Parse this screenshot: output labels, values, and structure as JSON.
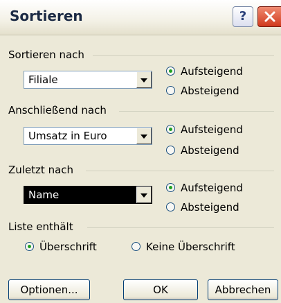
{
  "window": {
    "title": "Sortieren"
  },
  "groups": {
    "sort_by": {
      "label": "Sortieren nach",
      "field": "Filiale",
      "ascending": "Aufsteigend",
      "descending": "Absteigend",
      "selected": "ascending"
    },
    "then_by": {
      "label": "Anschließend nach",
      "field": "Umsatz in Euro",
      "ascending": "Aufsteigend",
      "descending": "Absteigend",
      "selected": "ascending"
    },
    "last_by": {
      "label": "Zuletzt nach",
      "field": "Name",
      "ascending": "Aufsteigend",
      "descending": "Absteigend",
      "selected": "ascending"
    },
    "list_contains": {
      "label": "Liste enthält",
      "header": "Überschrift",
      "no_header": "Keine Überschrift",
      "selected": "header"
    }
  },
  "buttons": {
    "options": "Optionen...",
    "ok": "OK",
    "cancel": "Abbrechen"
  }
}
